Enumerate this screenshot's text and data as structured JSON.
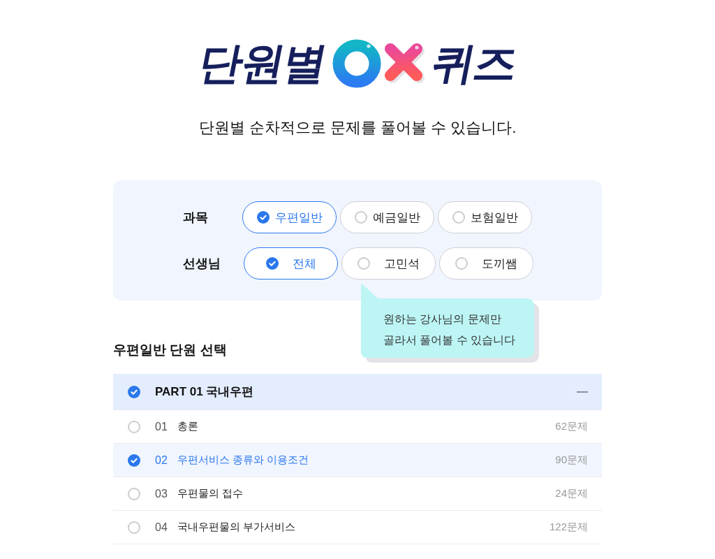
{
  "logo": {
    "title_start": "단원별",
    "title_end": "퀴즈"
  },
  "subtitle": "단원별 순차적으로 문제를 풀어볼 수 있습니다.",
  "filters": [
    {
      "label": "과목",
      "options": [
        {
          "label": "우편일반",
          "selected": true
        },
        {
          "label": "예금일반",
          "selected": false
        },
        {
          "label": "보험일반",
          "selected": false
        }
      ]
    },
    {
      "label": "선생님",
      "options": [
        {
          "label": "전체",
          "selected": true
        },
        {
          "label": "고민석",
          "selected": false
        },
        {
          "label": "도끼쌤",
          "selected": false
        }
      ]
    }
  ],
  "tooltip": {
    "lines": [
      "원하는 강사님의 문제만",
      "골라서 풀어볼 수 있습니다"
    ]
  },
  "section_title": "우편일반 단원 선택",
  "parts": [
    {
      "title": "PART 01 국내우편",
      "checked": true,
      "expanded": true,
      "units": [
        {
          "number": "01",
          "title": "총론",
          "count": "62문제",
          "selected": false
        },
        {
          "number": "02",
          "title": "우편서비스 종류와 이용조건",
          "count": "90문제",
          "selected": true
        },
        {
          "number": "03",
          "title": "우편물의 접수",
          "count": "24문제",
          "selected": false
        },
        {
          "number": "04",
          "title": "국내우편물의 부가서비스",
          "count": "122문제",
          "selected": false
        }
      ]
    }
  ]
}
